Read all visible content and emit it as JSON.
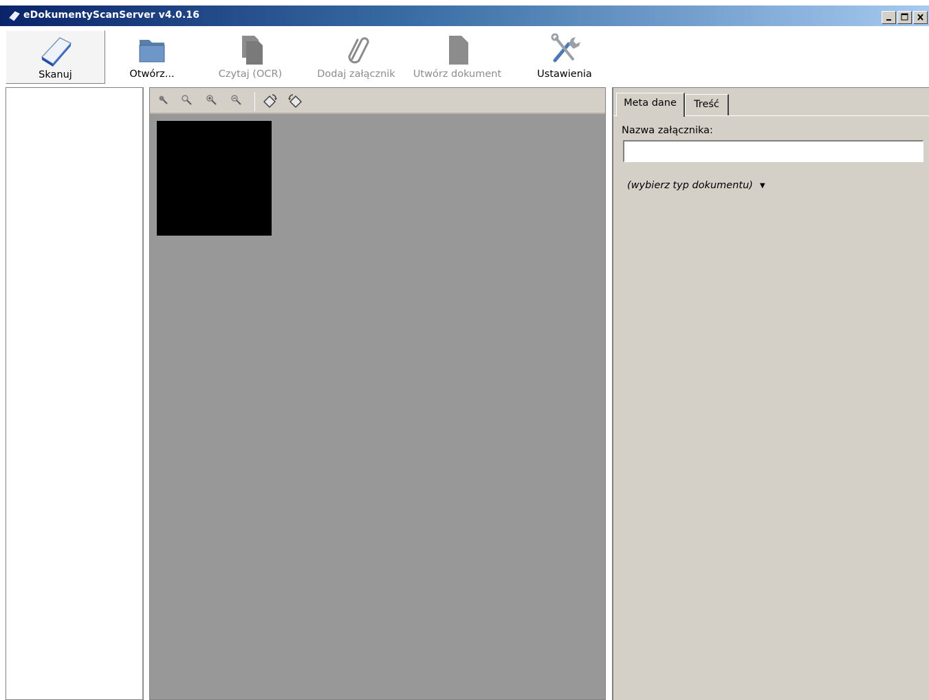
{
  "window": {
    "title": "eDokumentyScanServer v4.0.16"
  },
  "toolbar": {
    "scan_label": "Skanuj",
    "open_label": "Otwórz...",
    "ocr_label": "Czytaj (OCR)",
    "attach_label": "Dodaj załącznik",
    "create_doc_label": "Utwórz dokument",
    "settings_label": "Ustawienia"
  },
  "right_panel": {
    "tabs": [
      {
        "label": "Meta dane",
        "active": true
      },
      {
        "label": "Treść",
        "active": false
      }
    ],
    "attachment_name_label": "Nazwa załącznika:",
    "attachment_name_value": "",
    "doc_type_selector": "(wybierz typ dokumentu)"
  },
  "colors": {
    "title_gradient_start": "#0a246a",
    "title_gradient_end": "#a6caf0",
    "panel_bg": "#d4d0c8",
    "viewer_bg": "#989898",
    "disabled_text": "#8c8c8c"
  }
}
